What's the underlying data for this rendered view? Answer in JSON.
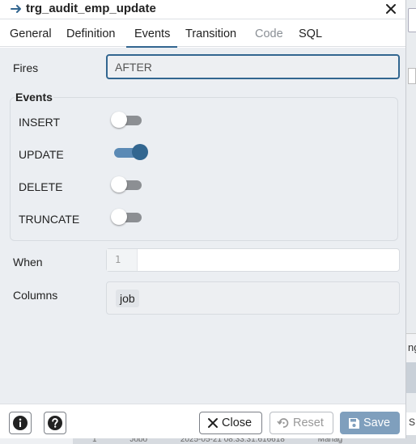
{
  "dialog": {
    "title": "trg_audit_emp_update"
  },
  "tabs": [
    {
      "label": "General",
      "state": "normal"
    },
    {
      "label": "Definition",
      "state": "normal"
    },
    {
      "label": "Events",
      "state": "active"
    },
    {
      "label": "Transition",
      "state": "normal"
    },
    {
      "label": "Code",
      "state": "disabled"
    },
    {
      "label": "SQL",
      "state": "normal"
    }
  ],
  "fires": {
    "label": "Fires",
    "value": "AFTER"
  },
  "events": {
    "legend": "Events",
    "items": [
      {
        "label": "INSERT",
        "on": false
      },
      {
        "label": "UPDATE",
        "on": true
      },
      {
        "label": "DELETE",
        "on": false
      },
      {
        "label": "TRUNCATE",
        "on": false
      }
    ]
  },
  "when": {
    "label": "When",
    "line_number": "1",
    "value": ""
  },
  "columns": {
    "label": "Columns",
    "selected": [
      "job"
    ]
  },
  "footer": {
    "close_label": "Close",
    "reset_label": "Reset",
    "save_label": "Save"
  },
  "background": {
    "header_fragment": "ng",
    "cell_fragment": "SM",
    "bottom_row": [
      "1",
      "Jobo",
      "2025-05-21 08:33:31.616618",
      "Manag"
    ]
  },
  "colors": {
    "accent": "#326690",
    "toggle_off": "#8c8f93",
    "save_button": "#7f9fbd",
    "panel_background": "#ebeef2"
  },
  "icons": {
    "title": "arrow-right-icon",
    "close": "close-icon",
    "info": "info-icon",
    "help": "help-icon",
    "close_button": "x-icon",
    "reset": "reset-icon",
    "save": "save-icon"
  }
}
